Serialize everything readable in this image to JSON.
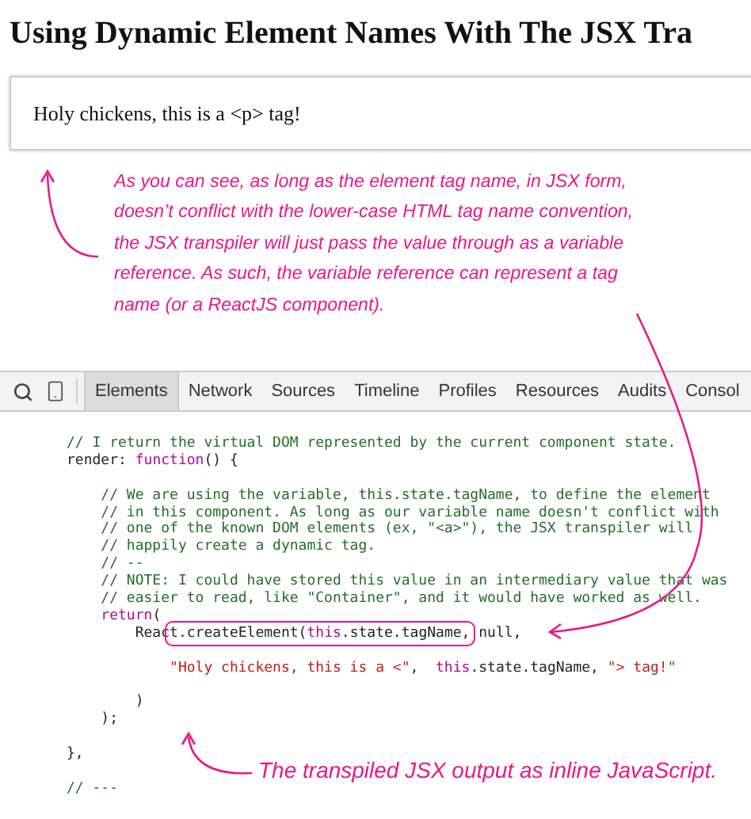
{
  "page": {
    "heading": "Using Dynamic Element Names With The JSX Tra",
    "output": "Holy chickens, this is a <p> tag!"
  },
  "annotations": [
    {
      "text": "As you can see, as long as the element tag name, in JSX form, doesn’t conflict with the lower-case HTML tag name convention, the JSX transpiler will just pass the value through as a variable reference. As such, the variable reference can represent a tag name (or a ReactJS component)."
    },
    {
      "text": "The transpiled JSX output as inline JavaScript."
    }
  ],
  "devtools": {
    "tabs": [
      {
        "label": "Elements",
        "selected": true
      },
      {
        "label": "Network",
        "selected": false
      },
      {
        "label": "Sources",
        "selected": false
      },
      {
        "label": "Timeline",
        "selected": false
      },
      {
        "label": "Profiles",
        "selected": false
      },
      {
        "label": "Resources",
        "selected": false
      },
      {
        "label": "Audits",
        "selected": false
      },
      {
        "label": "Consol",
        "selected": false
      }
    ],
    "code": [
      [
        {
          "kind": "comment",
          "text": "// I return the virtual DOM represented by the current component state."
        }
      ],
      [
        {
          "kind": "plain",
          "text": "render: "
        },
        {
          "kind": "keyword",
          "text": "function"
        },
        {
          "kind": "plain",
          "text": "() {"
        },
        {
          "kind": "gap"
        }
      ],
      [
        {
          "kind": "comment",
          "text": "    // We are using the variable, this.state.tagName, to define the element"
        }
      ],
      [
        {
          "kind": "comment",
          "text": "    // in this component. As long as our variable name doesn't conflict with"
        }
      ],
      [
        {
          "kind": "comment",
          "text": "    // one of the known DOM elements (ex, \"<a>\"), the JSX transpiler will"
        }
      ],
      [
        {
          "kind": "comment",
          "text": "    // happily create a dynamic tag."
        }
      ],
      [
        {
          "kind": "comment",
          "text": "    // --"
        }
      ],
      [
        {
          "kind": "comment",
          "text": "    // NOTE: I could have stored this value in an intermediary value that was"
        }
      ],
      [
        {
          "kind": "comment",
          "text": "    // easier to read, like \"Container\", and it would have worked as well."
        }
      ],
      [
        {
          "kind": "keyword",
          "text": "    return"
        },
        {
          "kind": "plain",
          "text": "("
        }
      ],
      [
        {
          "kind": "plain",
          "text": "        Reac"
        },
        {
          "kind": "highlight",
          "parts": [
            {
              "kind": "plain",
              "text": "t.createElement("
            },
            {
              "kind": "keyword",
              "text": "this"
            },
            {
              "kind": "plain",
              "text": ".state.tagName,"
            }
          ]
        },
        {
          "kind": "plain",
          "text": " null,"
        },
        {
          "kind": "gap"
        }
      ],
      [
        {
          "kind": "string",
          "text": "            \"Holy chickens, this is a <\""
        },
        {
          "kind": "plain",
          "text": ",  "
        },
        {
          "kind": "keyword",
          "text": "this"
        },
        {
          "kind": "plain",
          "text": ".state.tagName, "
        },
        {
          "kind": "string",
          "text": "\"> tag!\""
        },
        {
          "kind": "gap"
        }
      ],
      [
        {
          "kind": "plain",
          "text": "        )"
        }
      ],
      [
        {
          "kind": "plain",
          "text": "    );"
        },
        {
          "kind": "gap"
        }
      ],
      [
        {
          "kind": "plain",
          "text": "},"
        },
        {
          "kind": "gap"
        }
      ],
      [
        {
          "kind": "comment",
          "text": "// ---"
        }
      ]
    ]
  }
}
